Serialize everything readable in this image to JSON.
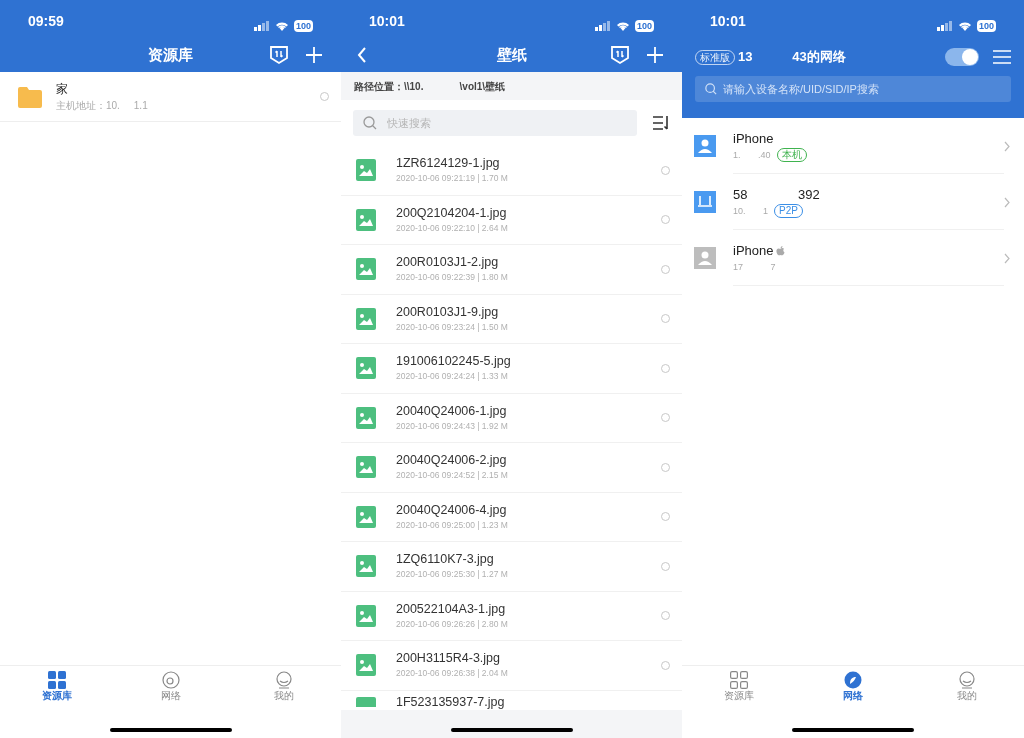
{
  "screens": [
    {
      "kind": "library",
      "status": {
        "time": "09:59",
        "battery": "100"
      },
      "header": {
        "title": "资源库"
      },
      "items": [
        {
          "name": "家",
          "subtitle": "主机地址：10.     1.1",
          "selected": false
        }
      ],
      "tabs": [
        {
          "label": "资源库",
          "selected": true
        },
        {
          "label": "网络",
          "selected": false
        },
        {
          "label": "我的",
          "selected": false
        }
      ]
    },
    {
      "kind": "folder",
      "status": {
        "time": "10:01",
        "battery": "100"
      },
      "header": {
        "title": "壁纸"
      },
      "path": "路径位置：\\\\10.             \\vol1\\壁纸",
      "search": {
        "placeholder": "快速搜索"
      },
      "files": [
        {
          "name": "1ZR6124129-1.jpg",
          "meta": "2020-10-06 09:21:19 | 1.70 M",
          "selected": false
        },
        {
          "name": "200Q2104204-1.jpg",
          "meta": "2020-10-06 09:22:10 | 2.64 M",
          "selected": false
        },
        {
          "name": "200R0103J1-2.jpg",
          "meta": "2020-10-06 09:22:39 | 1.80 M",
          "selected": false
        },
        {
          "name": "200R0103J1-9.jpg",
          "meta": "2020-10-06 09:23:24 | 1.50 M",
          "selected": false
        },
        {
          "name": "191006102245-5.jpg",
          "meta": "2020-10-06 09:24:24 | 1.33 M",
          "selected": false
        },
        {
          "name": "20040Q24006-1.jpg",
          "meta": "2020-10-06 09:24:43 | 1.92 M",
          "selected": false
        },
        {
          "name": "20040Q24006-2.jpg",
          "meta": "2020-10-06 09:24:52 | 2.15 M",
          "selected": false
        },
        {
          "name": "20040Q24006-4.jpg",
          "meta": "2020-10-06 09:25:00 | 1.23 M",
          "selected": false
        },
        {
          "name": "1ZQ6110K7-3.jpg",
          "meta": "2020-10-06 09:25:30 | 1.27 M",
          "selected": false
        },
        {
          "name": "200522104A3-1.jpg",
          "meta": "2020-10-06 09:26:26 | 2.80 M",
          "selected": false
        },
        {
          "name": "200H3115R4-3.jpg",
          "meta": "2020-10-06 09:26:38 | 2.04 M",
          "selected": false
        },
        {
          "name": "1F523135937-7.jpg"
        }
      ]
    },
    {
      "kind": "network",
      "status": {
        "time": "10:01",
        "battery": "100"
      },
      "header": {
        "badge": "标准版",
        "title": "13           43的网络",
        "toggle_on": true
      },
      "search": {
        "placeholder": "请输入设备名称/UID/SID/IP搜索"
      },
      "devices": [
        {
          "kind": "person",
          "name": "iPhone",
          "address": "1.       .40",
          "tag": {
            "label": "本机",
            "color": "#3fb34f"
          },
          "apple": false,
          "active": true
        },
        {
          "kind": "router",
          "name": "58              392",
          "address": "10.       1",
          "tag": {
            "label": "P2P",
            "color": "#3a8ee6"
          },
          "apple": false,
          "active": true
        },
        {
          "kind": "person",
          "name": "iPhone",
          "address": "17           7",
          "apple": true,
          "active": false
        }
      ],
      "tabs": [
        {
          "label": "资源库",
          "selected": false
        },
        {
          "label": "网络",
          "selected": true
        },
        {
          "label": "我的",
          "selected": false
        }
      ]
    }
  ]
}
